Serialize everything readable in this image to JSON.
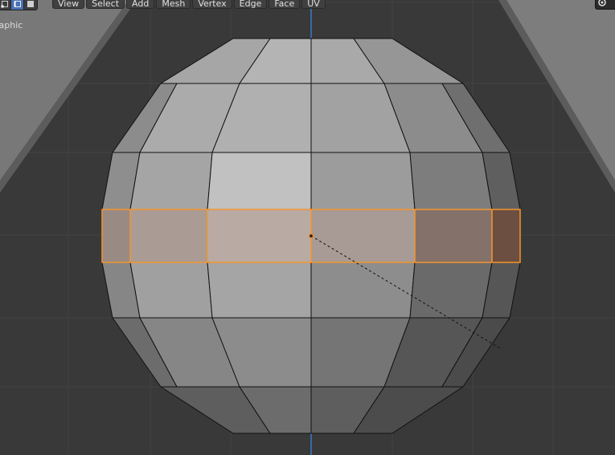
{
  "viewport": {
    "view_label": "raphic",
    "header": {
      "select_modes": [
        {
          "icon": "vertex-select-icon",
          "active": false
        },
        {
          "icon": "edge-select-icon",
          "active": true
        },
        {
          "icon": "face-select-icon",
          "active": false
        }
      ],
      "menus": [
        "View",
        "Select",
        "Add",
        "Mesh",
        "Vertex",
        "Edge",
        "Face",
        "UV"
      ]
    },
    "gizmo_icon": "view-options-icon"
  },
  "colors": {
    "background": "#393939",
    "grid_line": "#434343",
    "y_axis": "#3c78c8",
    "selection": "#f4962d",
    "header_active": "#4772b3",
    "mesh_edge": "#111111"
  }
}
